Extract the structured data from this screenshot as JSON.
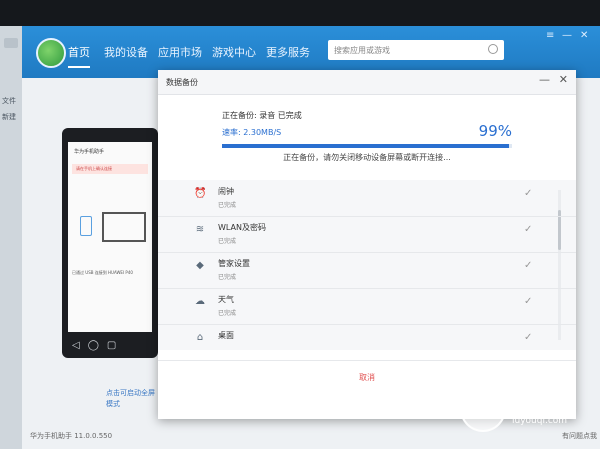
{
  "app": {
    "nav": [
      "首页",
      "我的设备",
      "应用市场",
      "游戏中心",
      "更多服务"
    ],
    "search_placeholder": "搜索应用或游戏",
    "window_controls": [
      "≡",
      "—",
      "✕"
    ],
    "version": "华为手机助手 11.0.0.550",
    "help": "有问题点我"
  },
  "phone": {
    "title": "华为手机助手",
    "banner": "请在手机上确认连接",
    "caption": "已通过 USB 连接到 HUAWEI P40",
    "hint_lines": [
      "点击可启动全屏",
      "模式"
    ]
  },
  "left_strip": [
    "文件",
    "新建"
  ],
  "dialog": {
    "title": "数据备份",
    "status": "正在备份: 录音  已完成",
    "speed": "速率: 2.30MB/S",
    "progress_percent": 99,
    "percent_label": "99%",
    "note": "正在备份，请勿关闭移动设备屏幕或断开连接...",
    "items": [
      {
        "name": "闹钟",
        "status": "已完成",
        "icon": "alarm-icon",
        "glyph": "⏰"
      },
      {
        "name": "WLAN及密码",
        "status": "已完成",
        "icon": "wifi-icon",
        "glyph": "≋"
      },
      {
        "name": "管家设置",
        "status": "已完成",
        "icon": "shield-icon",
        "glyph": "◆"
      },
      {
        "name": "天气",
        "status": "已完成",
        "icon": "weather-icon",
        "glyph": "☁"
      },
      {
        "name": "桌面",
        "status": "",
        "icon": "home-icon",
        "glyph": "⌂"
      }
    ],
    "cancel": "取消"
  },
  "watermark": {
    "name": "路由器",
    "url": "luyouqi.com"
  }
}
